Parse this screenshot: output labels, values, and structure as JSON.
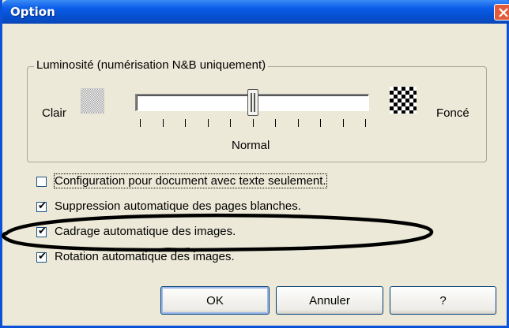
{
  "window": {
    "title": "Option"
  },
  "brightness": {
    "group_label": "Luminosité (numérisation N&B uniquement)",
    "light_label": "Clair",
    "dark_label": "Foncé",
    "slider_caption": "Normal",
    "slider_value_fraction": 0.5,
    "tick_count": 11
  },
  "options": [
    {
      "label": "Configuration pour document avec texte seulement.",
      "checked": false
    },
    {
      "label": "Suppression automatique des pages blanches.",
      "checked": true
    },
    {
      "label": "Cadrage automatique des images.",
      "checked": true
    },
    {
      "label": "Rotation automatique des images.",
      "checked": true
    }
  ],
  "buttons": {
    "ok": "OK",
    "cancel": "Annuler",
    "help": "?"
  },
  "colors": {
    "titlebar": "#0b5ce8",
    "dialog_bg": "#ece9d8",
    "close": "#e25c3a",
    "annotation": "#000000"
  }
}
